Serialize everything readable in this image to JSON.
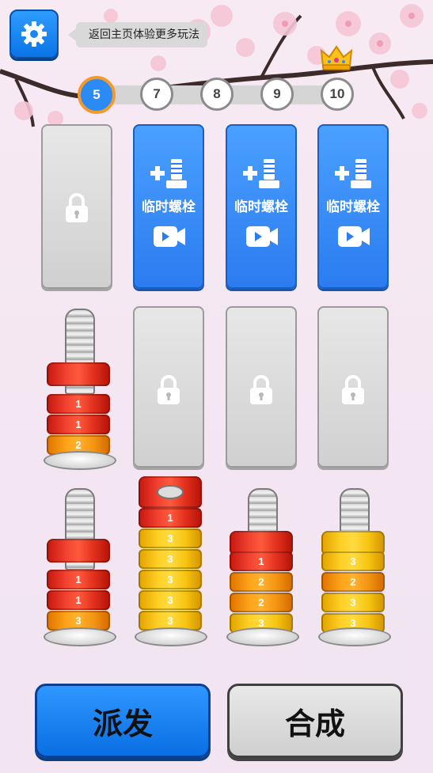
{
  "hint": {
    "text": "返回主页体验更多玩法"
  },
  "levels": {
    "current": "5",
    "items": [
      "5",
      "7",
      "8",
      "9",
      "10"
    ]
  },
  "icons": {
    "settings": "gear-icon",
    "crown": "crown-icon",
    "lock": "lock-icon",
    "add_screw": "add-screw-icon",
    "video": "video-ad-icon"
  },
  "extra_slot": {
    "label": "临时螺栓"
  },
  "screws": [
    {
      "nuts": [
        "1",
        "1",
        "2"
      ]
    },
    {
      "nuts": [
        "1",
        "3",
        "3",
        "3",
        "3",
        "3"
      ]
    },
    {
      "nuts": [
        "1",
        "2",
        "2",
        "3"
      ]
    },
    {
      "nuts": [
        "3",
        "2",
        "3",
        "3"
      ]
    }
  ],
  "buttons": {
    "dispatch": "派发",
    "merge": "合成"
  },
  "colors": {
    "nut_1": "#e3311f",
    "nut_2": "#f49412",
    "nut_3": "#f7c512",
    "primary_blue": "#2c7cf0",
    "level_ring": "#f29a2e"
  }
}
